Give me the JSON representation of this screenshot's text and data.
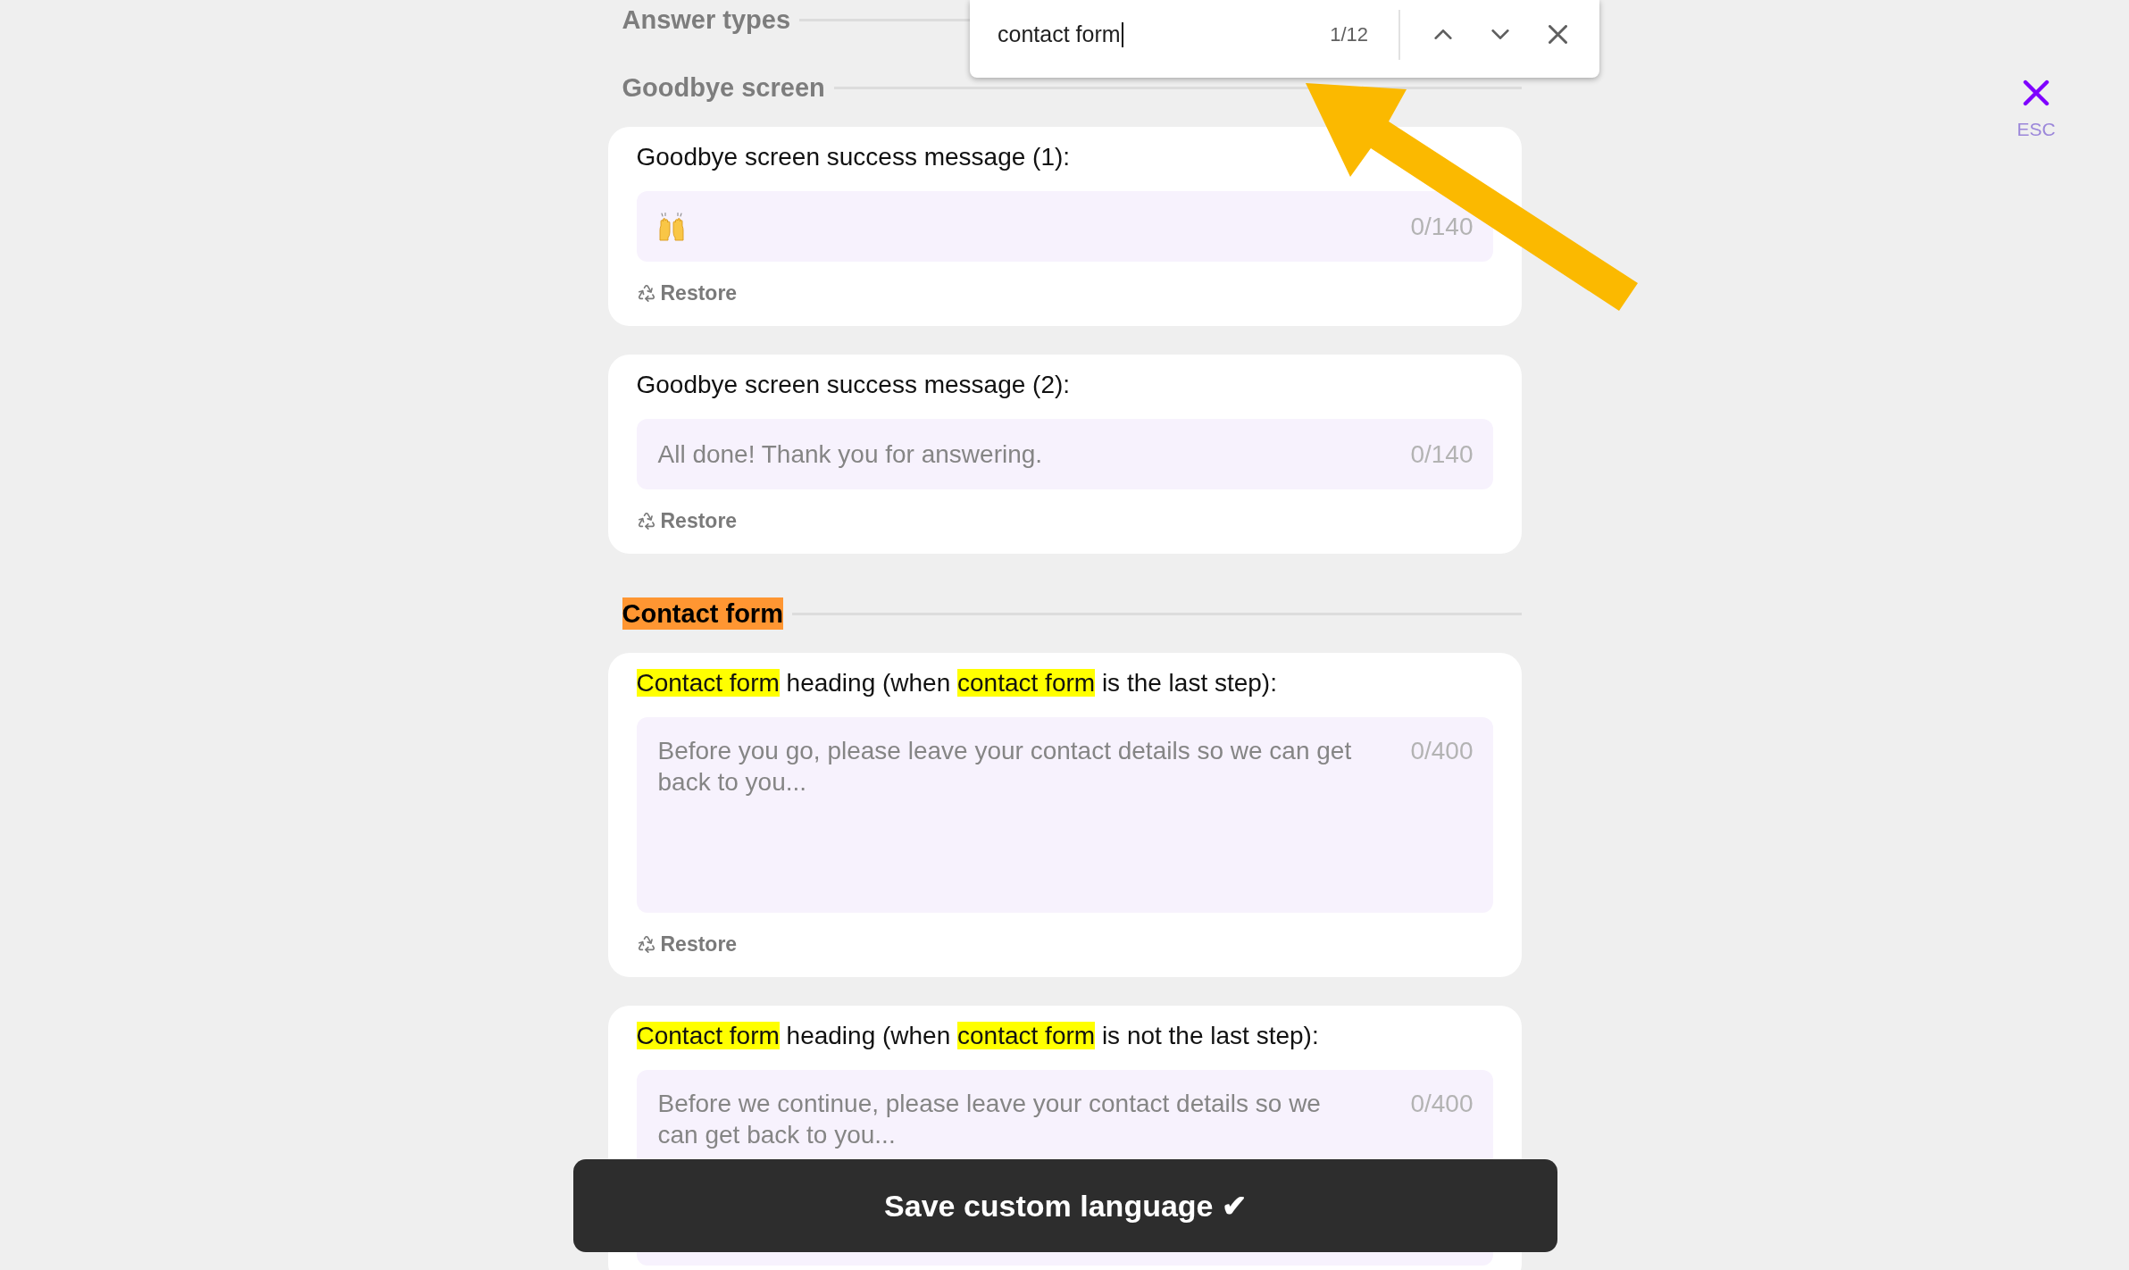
{
  "find_bar": {
    "query": "contact form",
    "count": "1/12"
  },
  "esc_button": {
    "label": "ESC"
  },
  "sections": [
    {
      "title": "Answer types",
      "current_match": false
    },
    {
      "title": "Goodbye screen",
      "current_match": false,
      "cards": [
        {
          "kind": "emoji",
          "label": [
            {
              "text": "Goodbye screen success message (1):",
              "match": false
            }
          ],
          "counter": "0/140",
          "restore": "Restore"
        },
        {
          "kind": "line",
          "label": [
            {
              "text": "Goodbye screen success message (2):",
              "match": false
            }
          ],
          "placeholder": "All done! Thank you for answering.",
          "counter": "0/140",
          "restore": "Restore"
        }
      ]
    },
    {
      "title": "Contact form",
      "current_match": true,
      "cards": [
        {
          "kind": "area",
          "label": [
            {
              "text": "Contact form",
              "match": true
            },
            {
              "text": " heading (when ",
              "match": false
            },
            {
              "text": "contact form",
              "match": true
            },
            {
              "text": " is the last step):",
              "match": false
            }
          ],
          "placeholder": "Before you go, please leave your contact details so we can get back to you...",
          "counter": "0/400",
          "restore": "Restore"
        },
        {
          "kind": "area",
          "label": [
            {
              "text": "Contact form",
              "match": true
            },
            {
              "text": " heading (when ",
              "match": false
            },
            {
              "text": "contact form",
              "match": true
            },
            {
              "text": " is not the last step):",
              "match": false
            }
          ],
          "placeholder": "Before we continue, please leave your contact details so we can get back to you...",
          "counter": "0/400"
        }
      ]
    }
  ],
  "save_button": {
    "label": "Save custom language ✔"
  }
}
